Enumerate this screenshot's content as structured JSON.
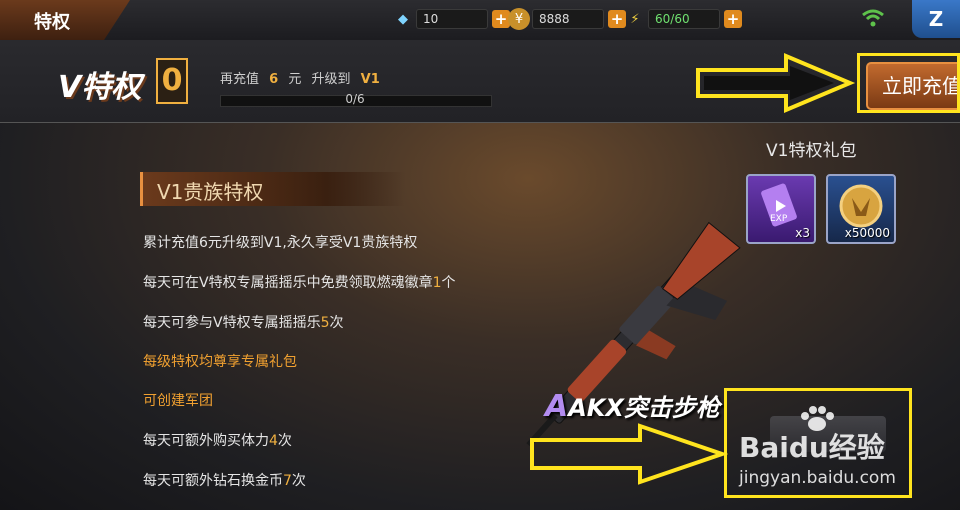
{
  "topbar": {
    "title": "特权",
    "diamonds": "10",
    "coins": "8888",
    "stamina": "60/60",
    "plus": "+",
    "corner_label": "Z"
  },
  "vip": {
    "logo": "V特权",
    "level": "0",
    "upgrade_prefix": "再充值",
    "upgrade_amount": "6",
    "upgrade_unit": "元",
    "upgrade_mid": "升级到",
    "upgrade_target": "V1",
    "progress_text": "0/6",
    "progress_fraction": 0,
    "recharge_label": "立即充值"
  },
  "privileges": {
    "title": "V1贵族特权",
    "items": [
      {
        "text": "累计充值6元升级到V1,永久享受V1贵族特权",
        "num": "",
        "tail": "",
        "gold": false
      },
      {
        "text": "每天可在V特权专属摇摇乐中免费领取燃魂徽章",
        "num": "1",
        "tail": "个",
        "gold": false
      },
      {
        "text": "每天可参与V特权专属摇摇乐",
        "num": "5",
        "tail": "次",
        "gold": false
      },
      {
        "text": "每级特权均尊享专属礼包",
        "num": "",
        "tail": "",
        "gold": true
      },
      {
        "text": "可创建军团",
        "num": "",
        "tail": "",
        "gold": true
      },
      {
        "text": "每天可额外购买体力",
        "num": "4",
        "tail": "次",
        "gold": false
      },
      {
        "text": "每天可额外钻石换金币",
        "num": "7",
        "tail": "次",
        "gold": false
      }
    ]
  },
  "gift": {
    "title": "V1特权礼包",
    "items": [
      {
        "icon": "exp-card-icon",
        "badge": "EXP",
        "qty": "x3"
      },
      {
        "icon": "gold-coin-icon",
        "qty": "x50000"
      }
    ]
  },
  "weapon": {
    "grade": "A",
    "name": "AKX突击步枪"
  },
  "watermark": {
    "main": "Baidu经验",
    "sub": "jingyan.baidu.com"
  }
}
